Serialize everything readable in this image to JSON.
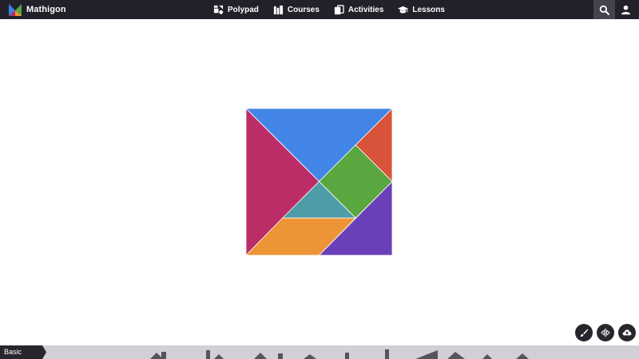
{
  "header": {
    "brand_name": "Mathigon",
    "nav": [
      {
        "label": "Polypad",
        "icon": "polypad-icon"
      },
      {
        "label": "Courses",
        "icon": "courses-icon"
      },
      {
        "label": "Activities",
        "icon": "activities-icon"
      },
      {
        "label": "Lessons",
        "icon": "lessons-icon"
      }
    ],
    "search_icon": "search-icon",
    "user_icon": "user-icon"
  },
  "canvas": {
    "tangram_pieces": [
      {
        "name": "large-triangle-top",
        "color": "#4285e7"
      },
      {
        "name": "large-triangle-left",
        "color": "#bb2d66"
      },
      {
        "name": "small-triangle-right",
        "color": "#d9523a"
      },
      {
        "name": "square",
        "color": "#5aa63f"
      },
      {
        "name": "small-triangle-middle",
        "color": "#4e9ca7"
      },
      {
        "name": "parallelogram",
        "color": "#ed9436"
      },
      {
        "name": "medium-triangle",
        "color": "#6a40b8"
      }
    ]
  },
  "actions": [
    {
      "name": "brush",
      "icon": "brush-icon"
    },
    {
      "name": "mirror",
      "icon": "mirror-icon"
    },
    {
      "name": "upload",
      "icon": "cloud-upload-icon"
    }
  ],
  "tray": {
    "tab_label": "Basic"
  },
  "colors": {
    "topbar_bg": "#22212a",
    "tray_bg": "#d0d0d6",
    "fab_bg": "#27262d"
  }
}
